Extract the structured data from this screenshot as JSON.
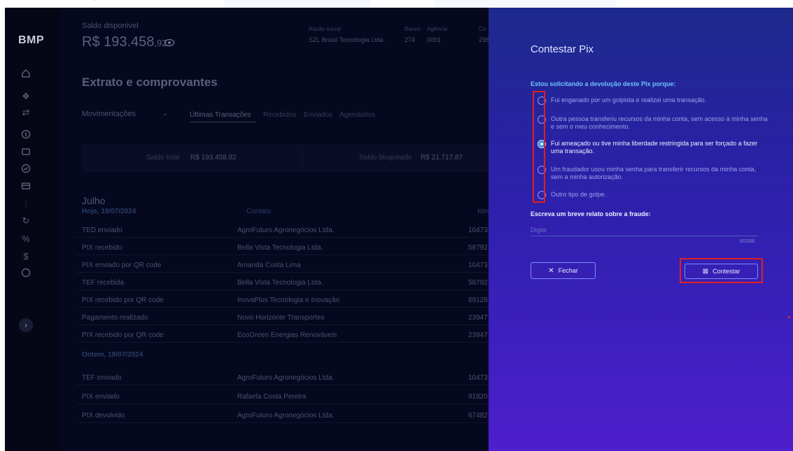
{
  "header": {
    "balance_label": "Saldo disponível",
    "balance_main": "R$ 193.458",
    "balance_cents": ",92",
    "razao_label": "Razão social",
    "razao_value": "SZL Brasil Tecnologia Ltda.",
    "banco_label": "Banco",
    "banco_value": "274",
    "agencia_label": "Agência",
    "agencia_value": "0001",
    "conta_label": "Co",
    "conta_value": "296"
  },
  "sidebar": {
    "logo": "BMP",
    "icons": [
      "home-icon",
      "grid-icon",
      "transfer-icon",
      "dollar-icon",
      "receipt-icon",
      "check-circle-icon",
      "card-icon",
      "sliders-icon",
      "refresh-icon",
      "percent-icon",
      "hand-money-icon",
      "help-icon"
    ]
  },
  "main": {
    "title": "Extrato e comprovantes",
    "select_value": "Movimentações",
    "tabs": [
      "Últimas Transações",
      "Recebidos",
      "Enviados",
      "Agendados"
    ],
    "summary": {
      "total_label": "Saldo total",
      "total_value": "R$ 193.458,92",
      "blocked_label": "Saldo bloqueado",
      "blocked_value": "R$ 21.717,87"
    },
    "month": "Julho",
    "columns": {
      "contact": "Contato",
      "id": "Identi"
    },
    "groups": [
      {
        "date": "Hoje, 19/07/2024",
        "rows": [
          {
            "type": "TED enviado",
            "contact": "AgroFuturo Agronegócios Ltda.",
            "id": "10473"
          },
          {
            "type": "PIX recebido",
            "contact": "Bella Vista Tecnologia Ltda.",
            "id": "58792"
          },
          {
            "type": "PIX enviado por QR code",
            "contact": "Amanda Costa Lima",
            "id": "10473"
          },
          {
            "type": "TEF recebida",
            "contact": "Bella Vista Tecnologia Ltda.",
            "id": "58792"
          },
          {
            "type": "PIX recebido por QR code",
            "contact": "InovaPlus Tecnologia e Inovação",
            "id": "69128"
          },
          {
            "type": "Pagamento realizado",
            "contact": "Novo Horizonte Transportes",
            "id": "23947"
          },
          {
            "type": "PIX recebido por QR code",
            "contact": "EcoGreen Energias Renováveis",
            "id": "23947"
          }
        ]
      },
      {
        "date": "Ontem, 18/07/2024",
        "rows": [
          {
            "type": "TEF enviado",
            "contact": "AgroFuturo Agronegócios Ltda.",
            "id": "10473"
          },
          {
            "type": "PIX enviado",
            "contact": "Rafaela Costa Pereira",
            "id": "91820"
          },
          {
            "type": "PIX devolvido",
            "contact": "AgroFuturo Agronegócios Ltda.",
            "id": "67482"
          }
        ]
      }
    ]
  },
  "panel": {
    "title": "Contestar Pix",
    "question": "Estou solicitando a devolução deste Pix porque:",
    "options": [
      {
        "text": "Fui enganado por um golpista e realizei uma  transação.",
        "selected": false
      },
      {
        "text": "Outra pessoa transferiu recursos da minha  conta, sem acesso à minha senha e sem o  meu conhecimento.",
        "selected": false
      },
      {
        "text": "Fui ameaçado ou tive minha liberdade  restringida para ser forçado a fazer uma  transação.",
        "selected": true
      },
      {
        "text": "Um fraudador usou minha senha para  transferir recursos da minha conta, sem a  minha autorização.",
        "selected": false
      },
      {
        "text": "Outro tipo de golpe.",
        "selected": false
      }
    ],
    "relato_label": "Escreva um breve relato sobre a fraude:",
    "relato_placeholder": "Digite",
    "counter": "0/1000",
    "close_label": "Fechar",
    "submit_label": "Contestar"
  }
}
